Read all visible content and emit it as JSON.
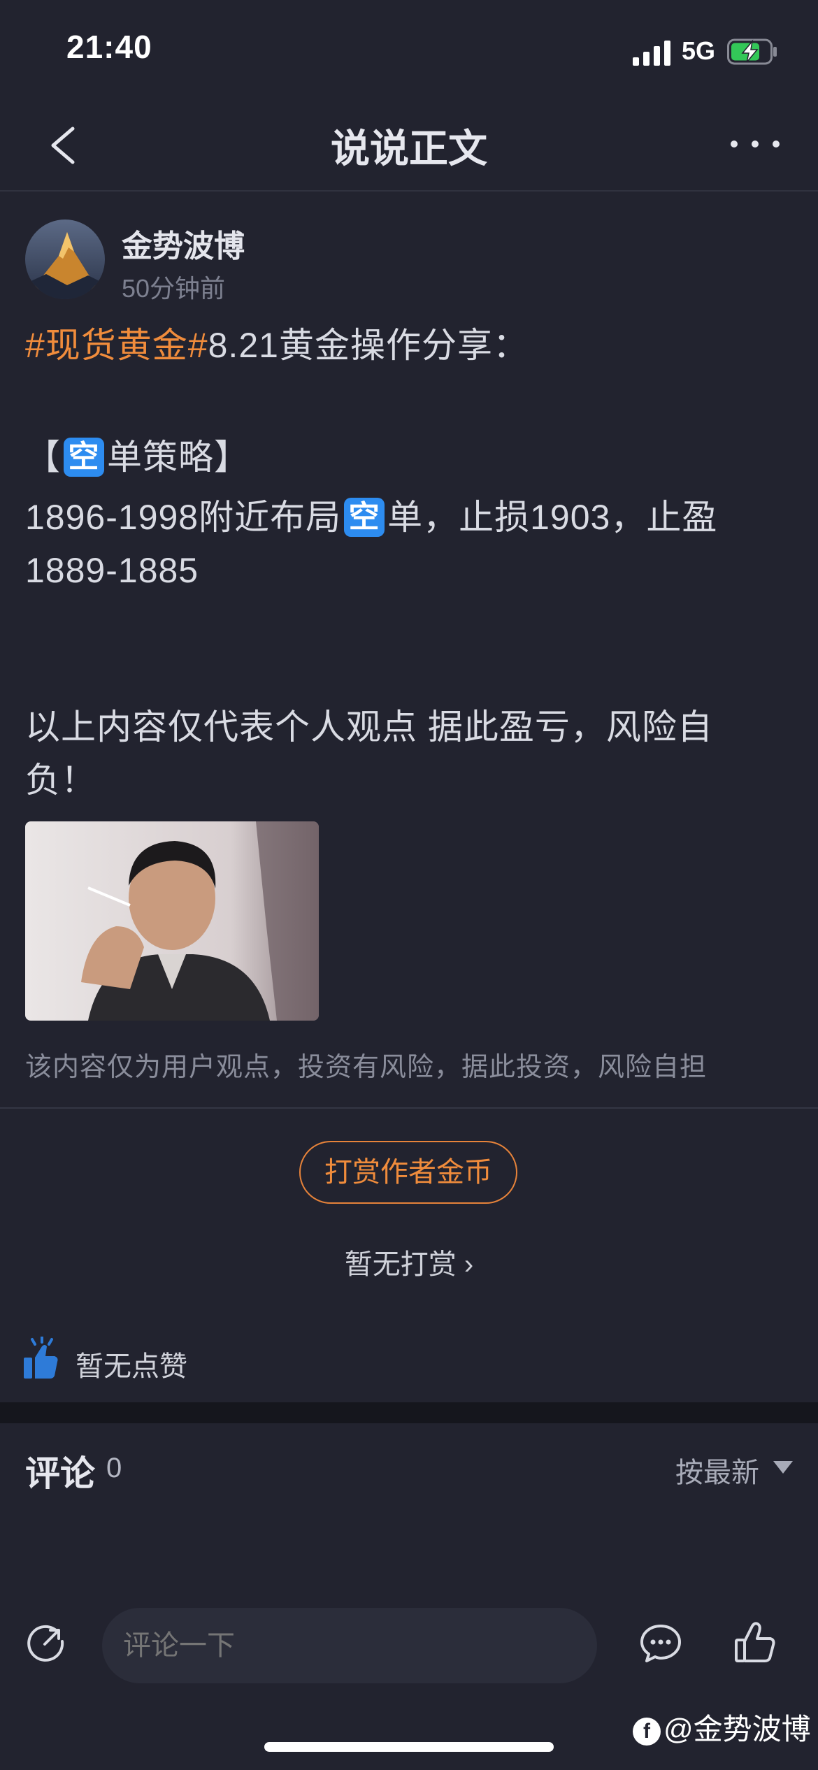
{
  "status_bar": {
    "time": "21:40",
    "network": "5G",
    "icons": [
      "signal-icon",
      "battery-charging-icon"
    ]
  },
  "nav": {
    "title": "说说正文",
    "icons": [
      "back-chevron-icon",
      "more-dots-icon"
    ]
  },
  "post": {
    "author": "金势波博",
    "time": "50分钟前",
    "hashtag": "#现货黄金#",
    "headline": "8.21黄金操作分享：",
    "strategy_open": "【",
    "emoji_label": "空",
    "strategy_close": "单策略】",
    "line1_a": "1896-1998附近布局",
    "line1_b": "单，止损1903，止盈",
    "line2": "1889-1885",
    "notice": "以上内容仅代表个人观点 据此盈亏，风险自负！",
    "disclaimer": "该内容仅为用户观点，投资有风险，据此投资，风险自担"
  },
  "tip": {
    "button_label": "打赏作者金币",
    "status": "暂无打赏 ›"
  },
  "likes": {
    "status": "暂无点赞"
  },
  "comments": {
    "title": "评论",
    "count": "0",
    "sort_label": "按最新"
  },
  "bottom_bar": {
    "input_placeholder": "评论一下",
    "icons": [
      "share-icon",
      "chat-bubble-icon",
      "thumbs-up-icon"
    ]
  },
  "watermark": {
    "logo": "f",
    "text": "@金势波博"
  },
  "colors": {
    "background": "#22232f",
    "accent_orange": "#f08c3c",
    "emoji_blue": "#2d8cf0",
    "like_blue": "#2e7bd8"
  }
}
